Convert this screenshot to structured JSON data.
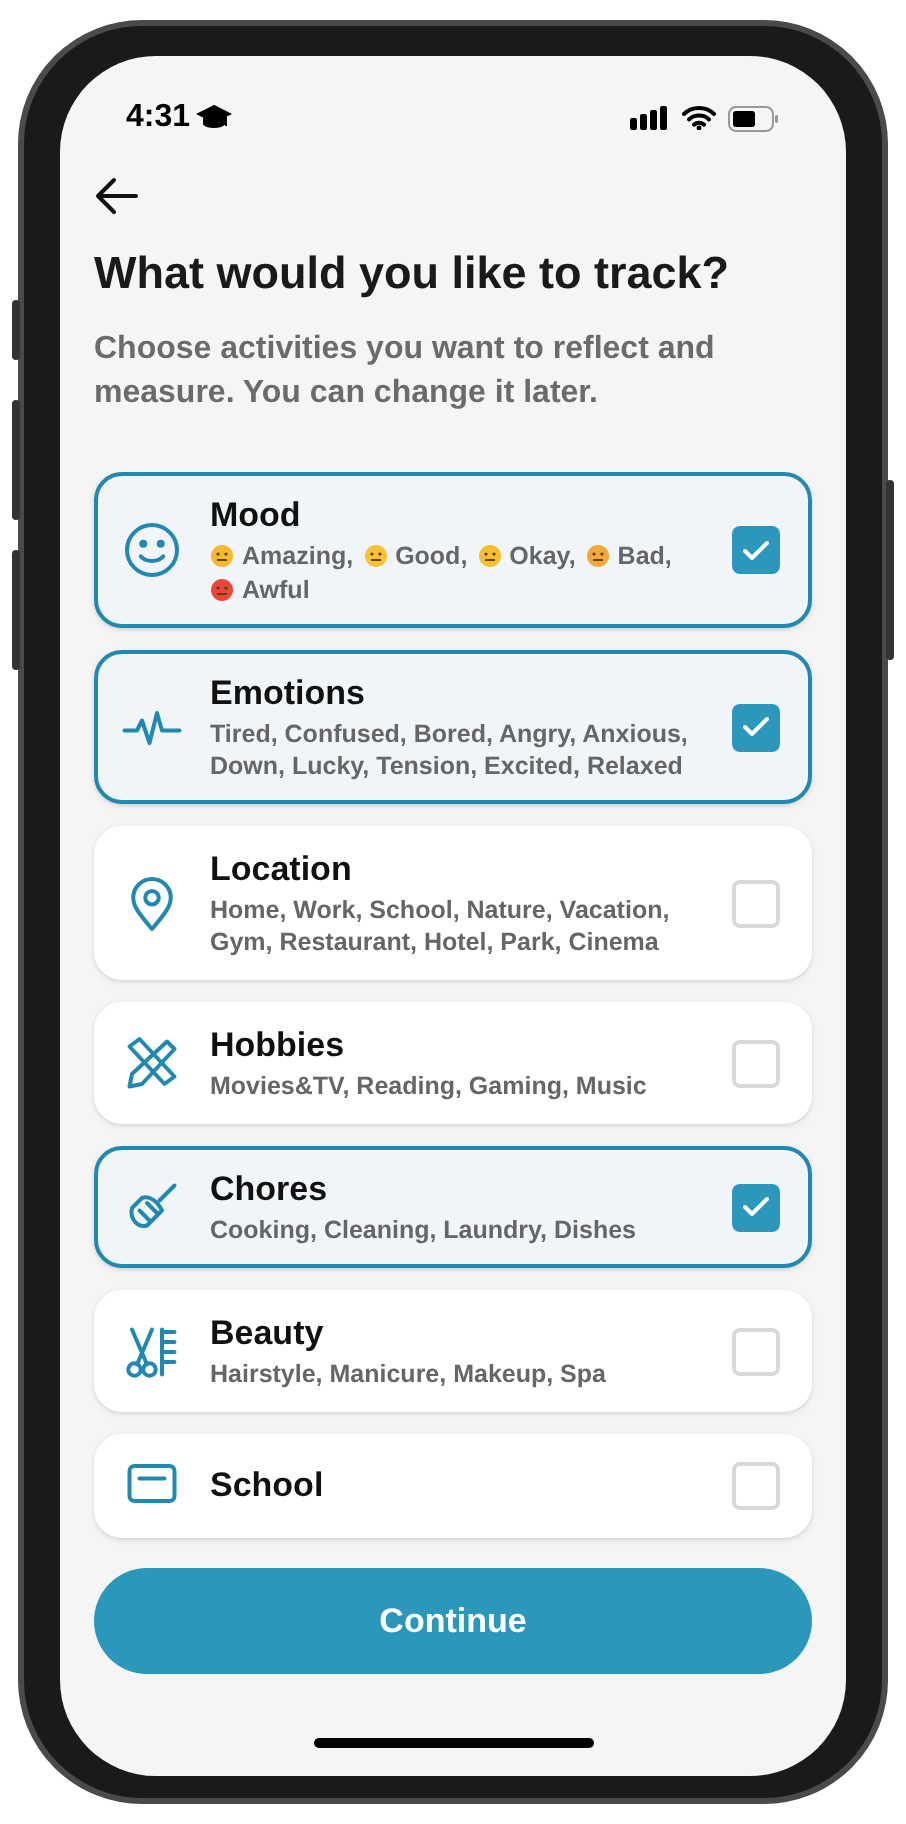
{
  "status_bar": {
    "time": "4:31"
  },
  "header": {
    "title": "What would you like to track?",
    "subtitle": "Choose activities you want to reflect and measure. You can change it later."
  },
  "activities": [
    {
      "kind": "moods",
      "title": "Mood",
      "checked": true,
      "moods": [
        {
          "label": "Amazing,",
          "color": "#f5b82e"
        },
        {
          "label": "Good,",
          "color": "#f7c23a"
        },
        {
          "label": "Okay,",
          "color": "#f5c030"
        },
        {
          "label": "Bad,",
          "color": "#f2a93b"
        },
        {
          "label": "Awful",
          "color": "#e8473a"
        }
      ]
    },
    {
      "kind": "text",
      "title": "Emotions",
      "checked": true,
      "description": "Tired, Confused, Bored, Angry, Anxious, Down, Lucky, Tension, Excited, Relaxed"
    },
    {
      "kind": "text",
      "title": "Location",
      "checked": false,
      "description": "Home, Work, School, Nature, Vacation, Gym, Restaurant, Hotel, Park, Cinema"
    },
    {
      "kind": "text",
      "title": "Hobbies",
      "checked": false,
      "description": "Movies&TV, Reading, Gaming, Music"
    },
    {
      "kind": "text",
      "title": "Chores",
      "checked": true,
      "description": "Cooking, Cleaning, Laundry, Dishes"
    },
    {
      "kind": "text",
      "title": "Beauty",
      "checked": false,
      "description": "Hairstyle, Manicure, Makeup, Spa"
    },
    {
      "kind": "text",
      "title": "School",
      "checked": false
    }
  ],
  "continue_button": "Continue"
}
